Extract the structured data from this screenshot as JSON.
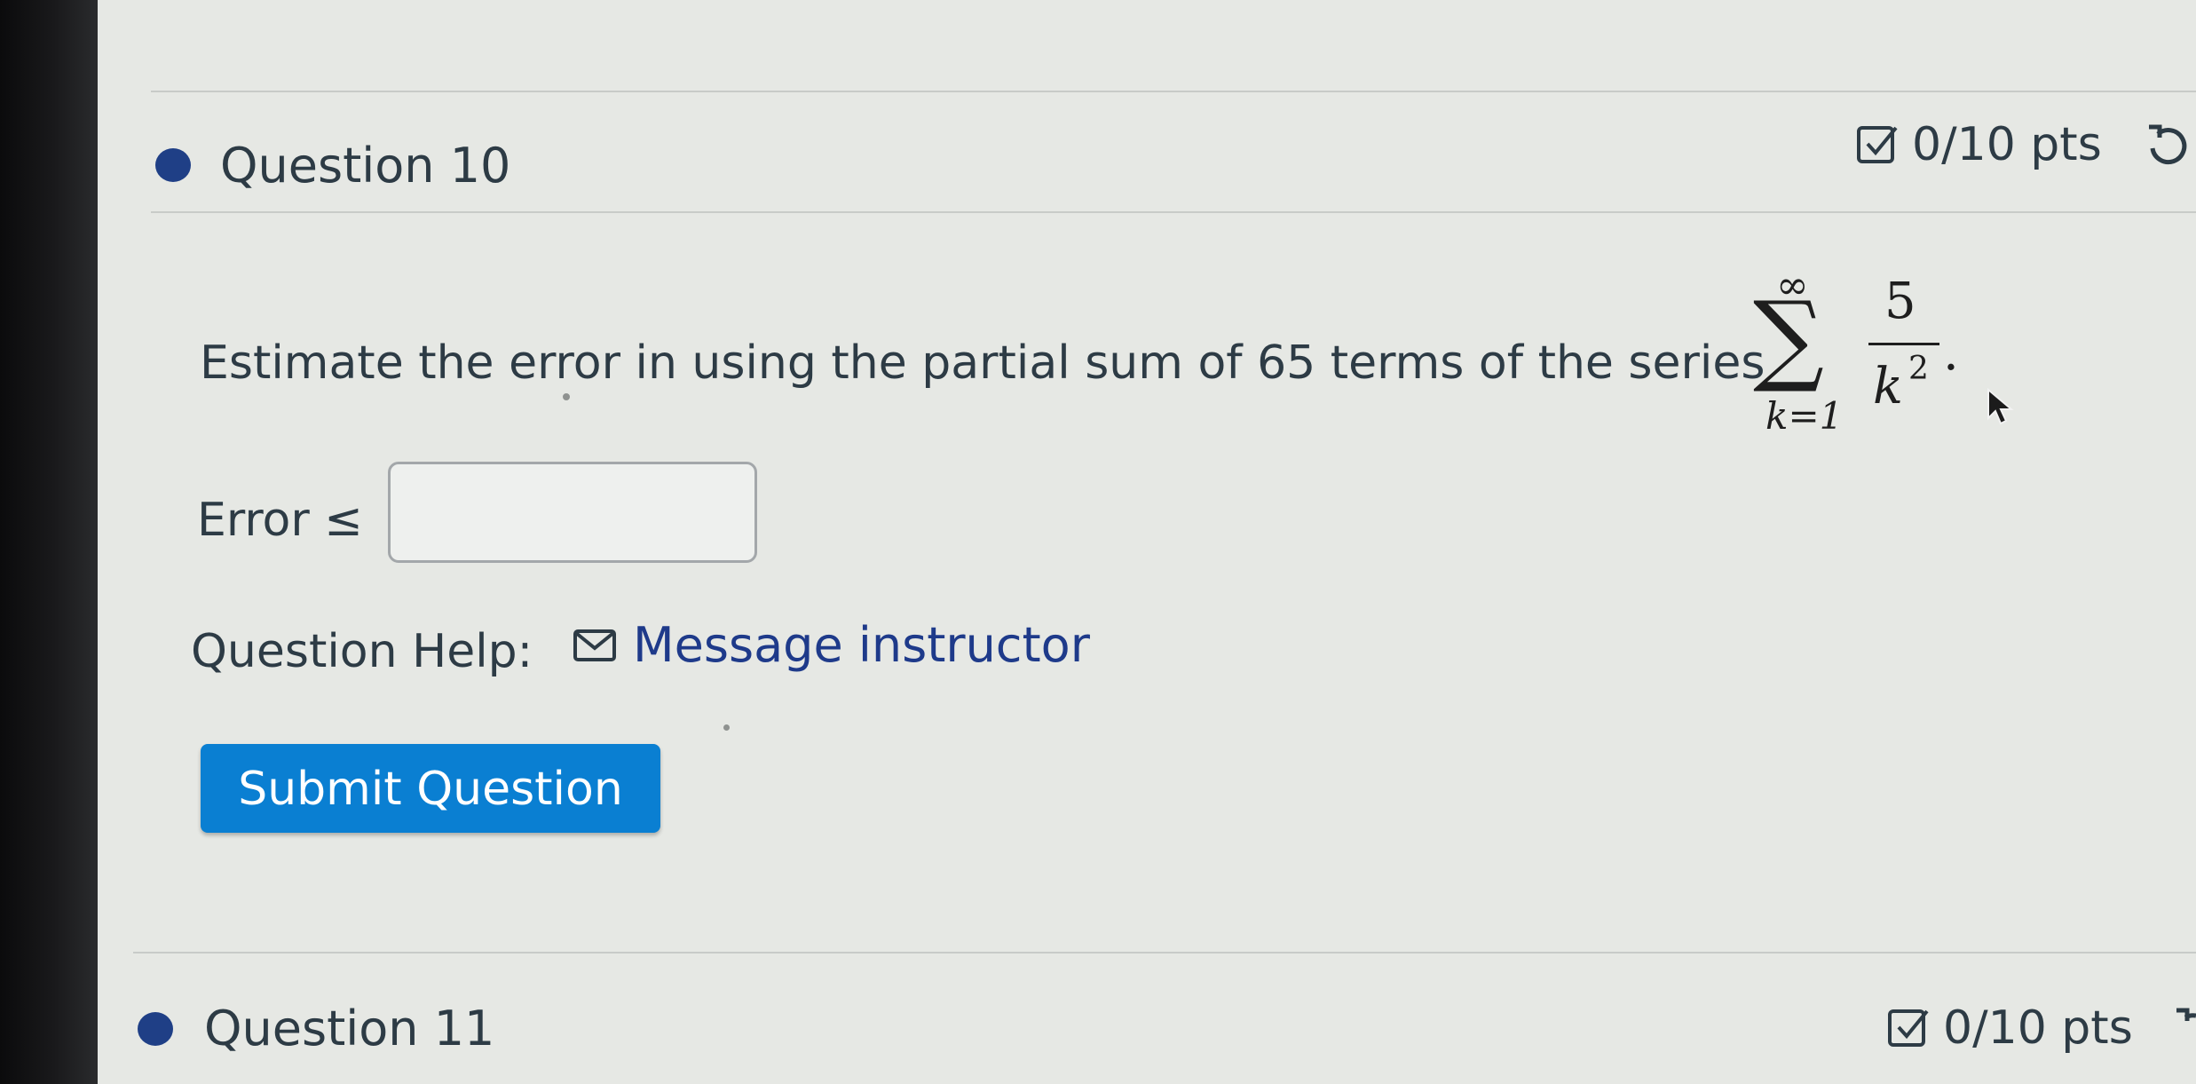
{
  "question10": {
    "title": "Question 10",
    "points": "0/10 pts",
    "prompt": "Estimate the error in using the partial sum of 65 terms of the series",
    "series": {
      "upper": "∞",
      "sigma": "∑",
      "lower": "k=1",
      "numerator": "5",
      "denominator": "k",
      "exponent": "2",
      "period": "."
    },
    "error_label": "Error ≤",
    "answer_value": "",
    "help_label": "Question Help:",
    "message_link": "Message instructor",
    "submit_label": "Submit Question"
  },
  "question11": {
    "title": "Question 11",
    "points": "0/10 pts"
  },
  "icons": {
    "status_dot": "status-dot-icon",
    "checkbox": "checkbox-check-icon",
    "retry": "retry-icon",
    "mail": "mail-icon",
    "cursor": "mouse-cursor-icon"
  },
  "colors": {
    "status_dot": "#1f3f86",
    "submit_button": "#0a7fd2",
    "link": "#1e3a8a",
    "text": "#2d3b45"
  }
}
